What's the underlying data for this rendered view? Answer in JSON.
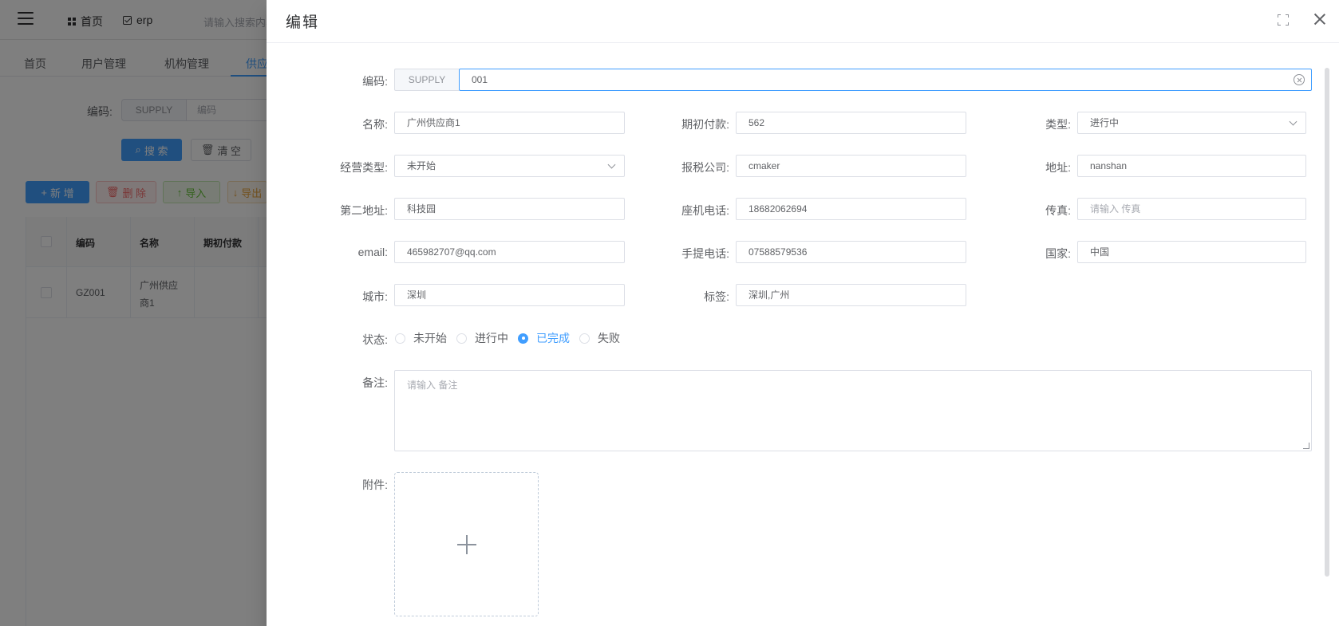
{
  "background": {
    "topbar": {
      "home_label": "首页",
      "erp_label": "erp",
      "search_placeholder": "请输入搜索内容"
    },
    "tabs": [
      "首页",
      "用户管理",
      "机构管理",
      "供应"
    ],
    "filter": {
      "code_label": "编码:",
      "code_prefix": "SUPPLY",
      "code_placeholder": "编码",
      "search_button": "搜 索",
      "clear_button": "清 空"
    },
    "toolbar": {
      "add_button": "新 增",
      "delete_button": "删 除",
      "import_button": "导入",
      "export_button": "导出"
    },
    "table": {
      "columns": [
        "编码",
        "名称",
        "期初付款"
      ],
      "rows": [
        {
          "code": "GZ001",
          "name": "广州供应商1",
          "payment": ""
        }
      ]
    }
  },
  "drawer": {
    "title": "编辑",
    "form": {
      "code": {
        "label": "编码:",
        "prefix": "SUPPLY",
        "value": "001"
      },
      "name": {
        "label": "名称:",
        "value": "广州供应商1"
      },
      "initial_payment": {
        "label": "期初付款:",
        "value": "562"
      },
      "type": {
        "label": "类型:",
        "value": "进行中"
      },
      "business_type": {
        "label": "经营类型:",
        "value": "未开始"
      },
      "tax_company": {
        "label": "报税公司:",
        "value": "cmaker"
      },
      "address": {
        "label": "地址:",
        "value": "nanshan"
      },
      "address2": {
        "label": "第二地址:",
        "value": "科技园"
      },
      "phone": {
        "label": "座机电话:",
        "value": "18682062694"
      },
      "fax": {
        "label": "传真:",
        "value": "",
        "placeholder": "请输入 传真"
      },
      "email": {
        "label": "email:",
        "value": "465982707@qq.com"
      },
      "mobile": {
        "label": "手提电话:",
        "value": "07588579536"
      },
      "country": {
        "label": "国家:",
        "value": "中国"
      },
      "city": {
        "label": "城市:",
        "value": "深圳"
      },
      "tags": {
        "label": "标签:",
        "value": "深圳,广州"
      },
      "status": {
        "label": "状态:",
        "options": [
          "未开始",
          "进行中",
          "已完成",
          "失败"
        ],
        "selected": "已完成"
      },
      "remark": {
        "label": "备注:",
        "value": "",
        "placeholder": "请输入 备注"
      },
      "attachment": {
        "label": "附件:"
      }
    }
  },
  "colors": {
    "primary": "#409eff",
    "danger": "#f56c6c",
    "success": "#67c23a",
    "warning": "#e6a23c",
    "overlay": "rgba(0,0,0,0.5)"
  },
  "icons": {
    "menu": "hamburger-icon",
    "home": "grid-icon",
    "erp": "checkbox-icon",
    "fullscreen": "fullscreen-icon",
    "close": "close-icon",
    "clear": "circle-close-icon",
    "select": "chevron-down-icon",
    "upload": "plus-icon"
  }
}
